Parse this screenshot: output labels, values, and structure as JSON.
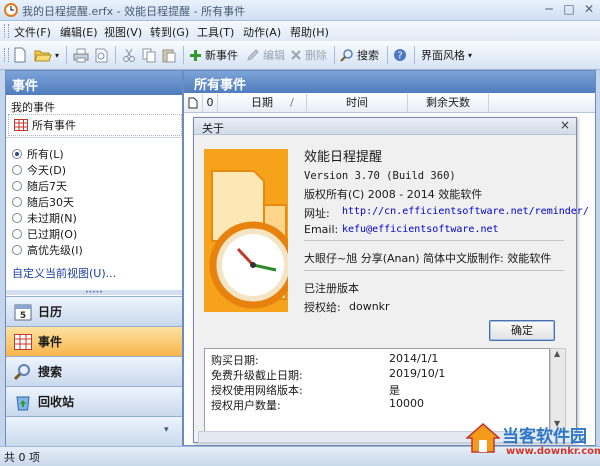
{
  "window": {
    "title": "我的日程提醒.erfx - 效能日程提醒 - 所有事件"
  },
  "menu": [
    {
      "label": "文件(F)"
    },
    {
      "label": "编辑(E)"
    },
    {
      "label": "视图(V)"
    },
    {
      "label": "转到(G)"
    },
    {
      "label": "工具(T)"
    },
    {
      "label": "动作(A)"
    },
    {
      "label": "帮助(H)"
    }
  ],
  "toolbar": {
    "new_event": "新事件",
    "edit": "编辑",
    "delete": "删除",
    "search": "搜索",
    "theme": "界面风格"
  },
  "left": {
    "header": "事件",
    "section": "我的事件",
    "all_events": "所有事件",
    "filters": [
      {
        "label": "所有(L)",
        "selected": true
      },
      {
        "label": "今天(D)",
        "selected": false
      },
      {
        "label": "随后7天",
        "selected": false
      },
      {
        "label": "随后30天",
        "selected": false
      },
      {
        "label": "未过期(N)",
        "selected": false
      },
      {
        "label": "已过期(O)",
        "selected": false
      },
      {
        "label": "高优先级(I)",
        "selected": false
      }
    ],
    "customize": "自定义当前视图(U)...",
    "nav": [
      {
        "label": "日历",
        "active": false
      },
      {
        "label": "事件",
        "active": true
      },
      {
        "label": "搜索",
        "active": false
      },
      {
        "label": "回收站",
        "active": false
      }
    ]
  },
  "right": {
    "header": "所有事件",
    "columns": {
      "attach": "0",
      "date": "日期",
      "sort": "/",
      "time": "时间",
      "remain": "剩余天数"
    }
  },
  "about": {
    "title": "关于",
    "close": "×",
    "product": "效能日程提醒",
    "version": "Version 3.70 (Build 360)",
    "copyright": "版权所有(C) 2008 - 2014 效能软件",
    "url_label": "网址:",
    "url": "http://cn.efficientsoftware.net/reminder/",
    "email_label": "Email:",
    "email": "kefu@efficientsoftware.net",
    "translator": "大眼仔~旭 分享(Anan) 简体中文版制作: 效能软件",
    "registered": "已注册版本",
    "licensed_label": "授权给:",
    "licensed_to": "downkr",
    "ok": "确定",
    "info": [
      {
        "key": "购买日期:",
        "value": "2014/1/1"
      },
      {
        "key": "免费升级截止日期:",
        "value": "2019/10/1"
      },
      {
        "key": "授权使用网络版本:",
        "value": "是"
      },
      {
        "key": "授权用户数量:",
        "value": "10000"
      }
    ]
  },
  "status": {
    "text": "共 0 项"
  },
  "watermark": {
    "brand": "当客软件园",
    "url": "www.downkr.com"
  },
  "colors": {
    "accent": "#4f7cbd",
    "active_nav": "#f7b54b",
    "link": "#0000cc"
  }
}
